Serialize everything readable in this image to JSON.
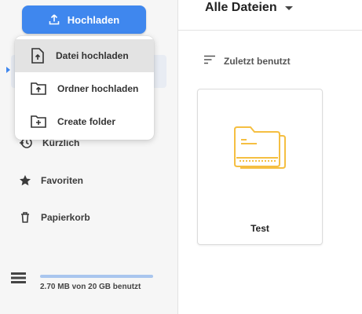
{
  "colors": {
    "accent": "#3f87ee",
    "folder": "#f5bf42"
  },
  "sidebar": {
    "upload_label": "Hochladen",
    "items": [
      {
        "label": "Kürzlich",
        "icon": "recent-icon"
      },
      {
        "label": "Favoriten",
        "icon": "star-icon"
      },
      {
        "label": "Papierkorb",
        "icon": "trash-icon"
      }
    ],
    "storage": {
      "text": "2.70 MB von 20 GB benutzt",
      "used_fraction": 0.000135
    }
  },
  "upload_menu": {
    "items": [
      {
        "label": "Datei hochladen",
        "icon": "file-upload-icon",
        "active": true
      },
      {
        "label": "Ordner hochladen",
        "icon": "folder-upload-icon",
        "active": false
      },
      {
        "label": "Create folder",
        "icon": "folder-add-icon",
        "active": false
      }
    ]
  },
  "main": {
    "title": "Alle Dateien",
    "sort_label": "Zuletzt benutzt",
    "files": [
      {
        "name": "Test",
        "type": "folder"
      }
    ]
  }
}
